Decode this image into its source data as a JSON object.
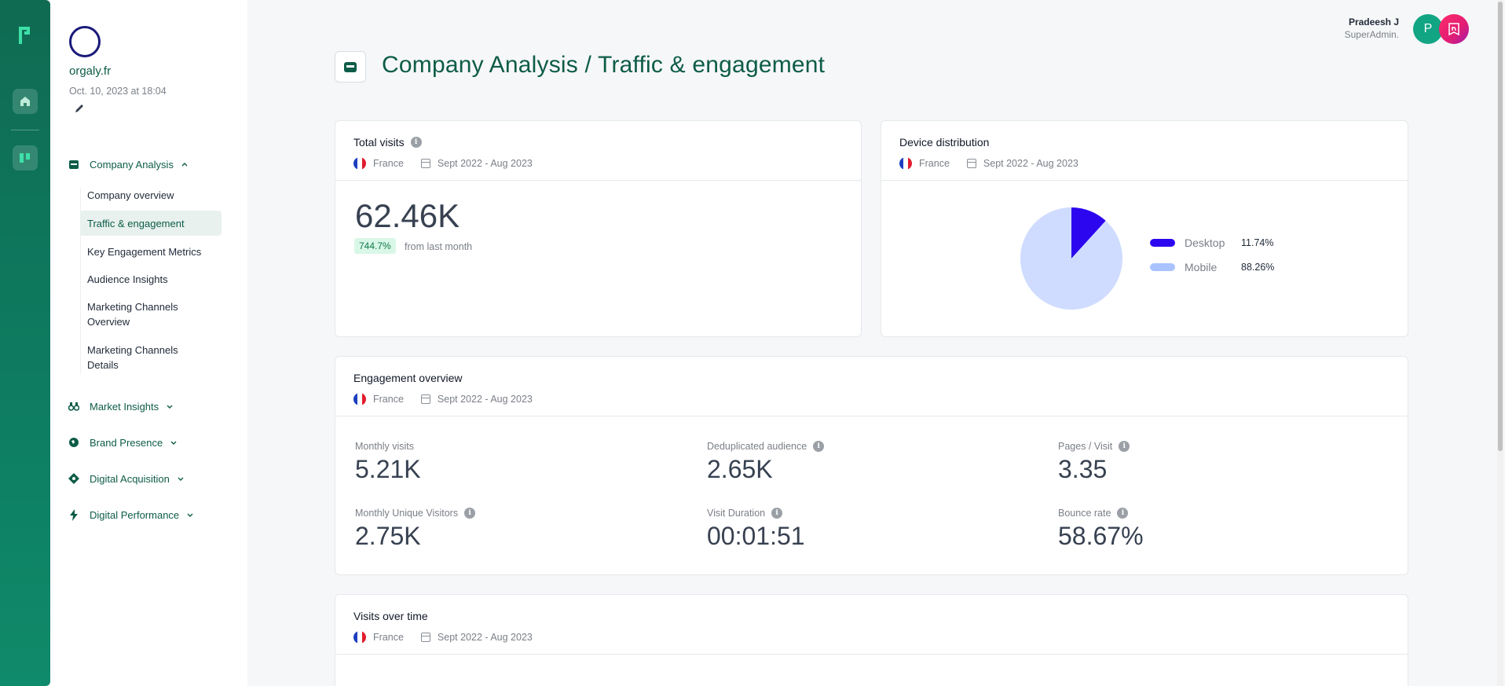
{
  "org": {
    "name": "orgaly.fr",
    "date": "Oct. 10, 2023 at 18:04"
  },
  "user": {
    "name": "Pradeesh J",
    "role": "SuperAdmin.",
    "avatar_initial": "P"
  },
  "page": {
    "title": "Company Analysis / Traffic & engagement"
  },
  "sidebar": {
    "sections": [
      {
        "label": "Company Analysis",
        "icon": "store-icon",
        "expanded": true
      },
      {
        "label": "Market Insights",
        "icon": "binoculars-icon",
        "expanded": false
      },
      {
        "label": "Brand Presence",
        "icon": "globe-icon",
        "expanded": false
      },
      {
        "label": "Digital Acquisition",
        "icon": "diamond-icon",
        "expanded": false
      },
      {
        "label": "Digital Performance",
        "icon": "bolt-icon",
        "expanded": false
      }
    ],
    "items": [
      "Company overview",
      "Traffic & engagement",
      "Key Engagement Metrics",
      "Audience Insights",
      "Marketing Channels Overview",
      "Marketing Channels Details"
    ],
    "active_item": "Traffic & engagement"
  },
  "common": {
    "country": "France",
    "period": "Sept 2022 - Aug 2023"
  },
  "total_visits": {
    "title": "Total visits",
    "value": "62.46K",
    "delta": "744.7%",
    "delta_text": "from last month"
  },
  "device": {
    "title": "Device distribution",
    "legend": [
      {
        "label": "Desktop",
        "value": "11.74%",
        "color": "#2b06ef"
      },
      {
        "label": "Mobile",
        "value": "88.26%",
        "color": "#a9c3ff"
      }
    ]
  },
  "chart_data": {
    "type": "pie",
    "categories": [
      "Desktop",
      "Mobile"
    ],
    "values": [
      11.74,
      88.26
    ],
    "colors": [
      "#2b06ef",
      "#cfdcff"
    ]
  },
  "engagement": {
    "title": "Engagement overview",
    "metrics": [
      {
        "label": "Monthly visits",
        "value": "5.21K",
        "info": false
      },
      {
        "label": "Deduplicated audience",
        "value": "2.65K",
        "info": true
      },
      {
        "label": "Pages / Visit",
        "value": "3.35",
        "info": true
      },
      {
        "label": "Monthly Unique Visitors",
        "value": "2.75K",
        "info": true
      },
      {
        "label": "Visit Duration",
        "value": "00:01:51",
        "info": true
      },
      {
        "label": "Bounce rate",
        "value": "58.67%",
        "info": true
      }
    ]
  },
  "visits_over_time": {
    "title": "Visits over time"
  },
  "colors": {
    "brand": "#0d5c47",
    "rail": "#0f7a5f",
    "positive": "#0f7a48"
  }
}
